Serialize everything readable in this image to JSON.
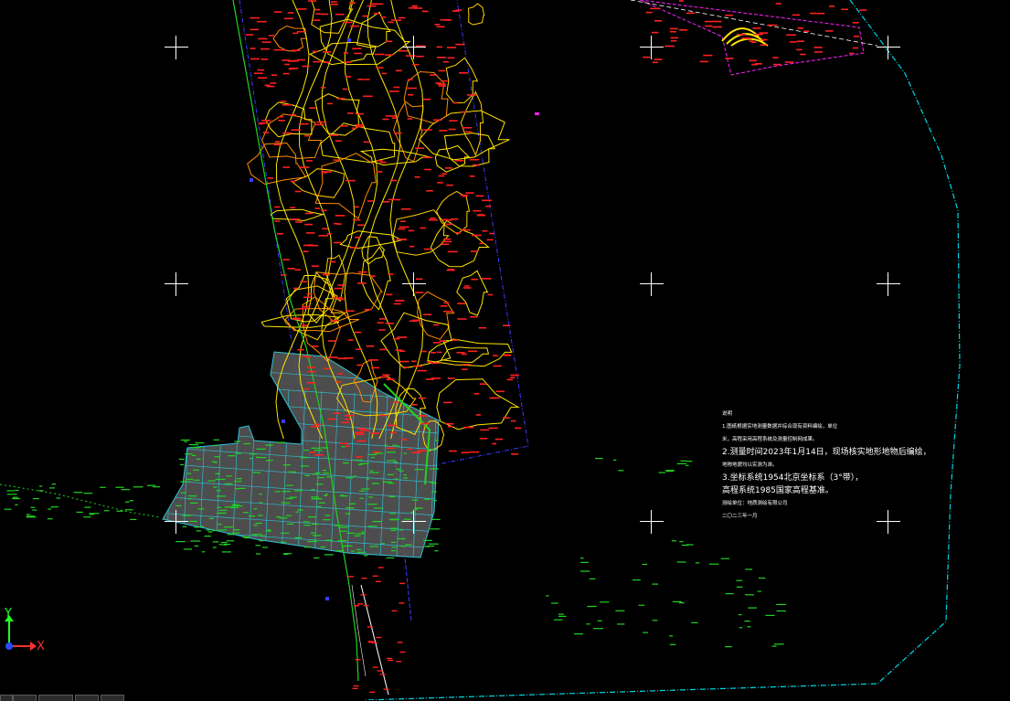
{
  "notes": {
    "title": "说明",
    "lines": [
      "1.图纸根据实地测量数据并综合现有资料编绘，单位",
      "米，高程采用高程系统及测量控制网成果。",
      "2.测量时间2023年1月14日，现场核实地形地物后编绘，",
      "地物地貌均以实测为准。",
      "3.坐标系统1954北京坐标系（3°带），",
      "高程系统1985国家高程基准。",
      "测绘单位：地质测绘有限公司",
      "二〇二三年一月"
    ],
    "bold_numbers": [
      "2023",
      "1954",
      "1985"
    ]
  },
  "ucs": {
    "y_label": "Y",
    "x_label": "X"
  },
  "colors": {
    "background": "#000000",
    "contour": "#ffe600",
    "contour_alt": "#ff8c00",
    "elevation_label": "#ff2020",
    "green_line": "#21d321",
    "boundary_blue": "#3b3bff",
    "boundary_cyan": "#00d8e6",
    "grid_cyan": "#2ec4d6",
    "fill_gray": "#5a5a5a",
    "magenta": "#ff1fff",
    "white": "#ffffff"
  }
}
